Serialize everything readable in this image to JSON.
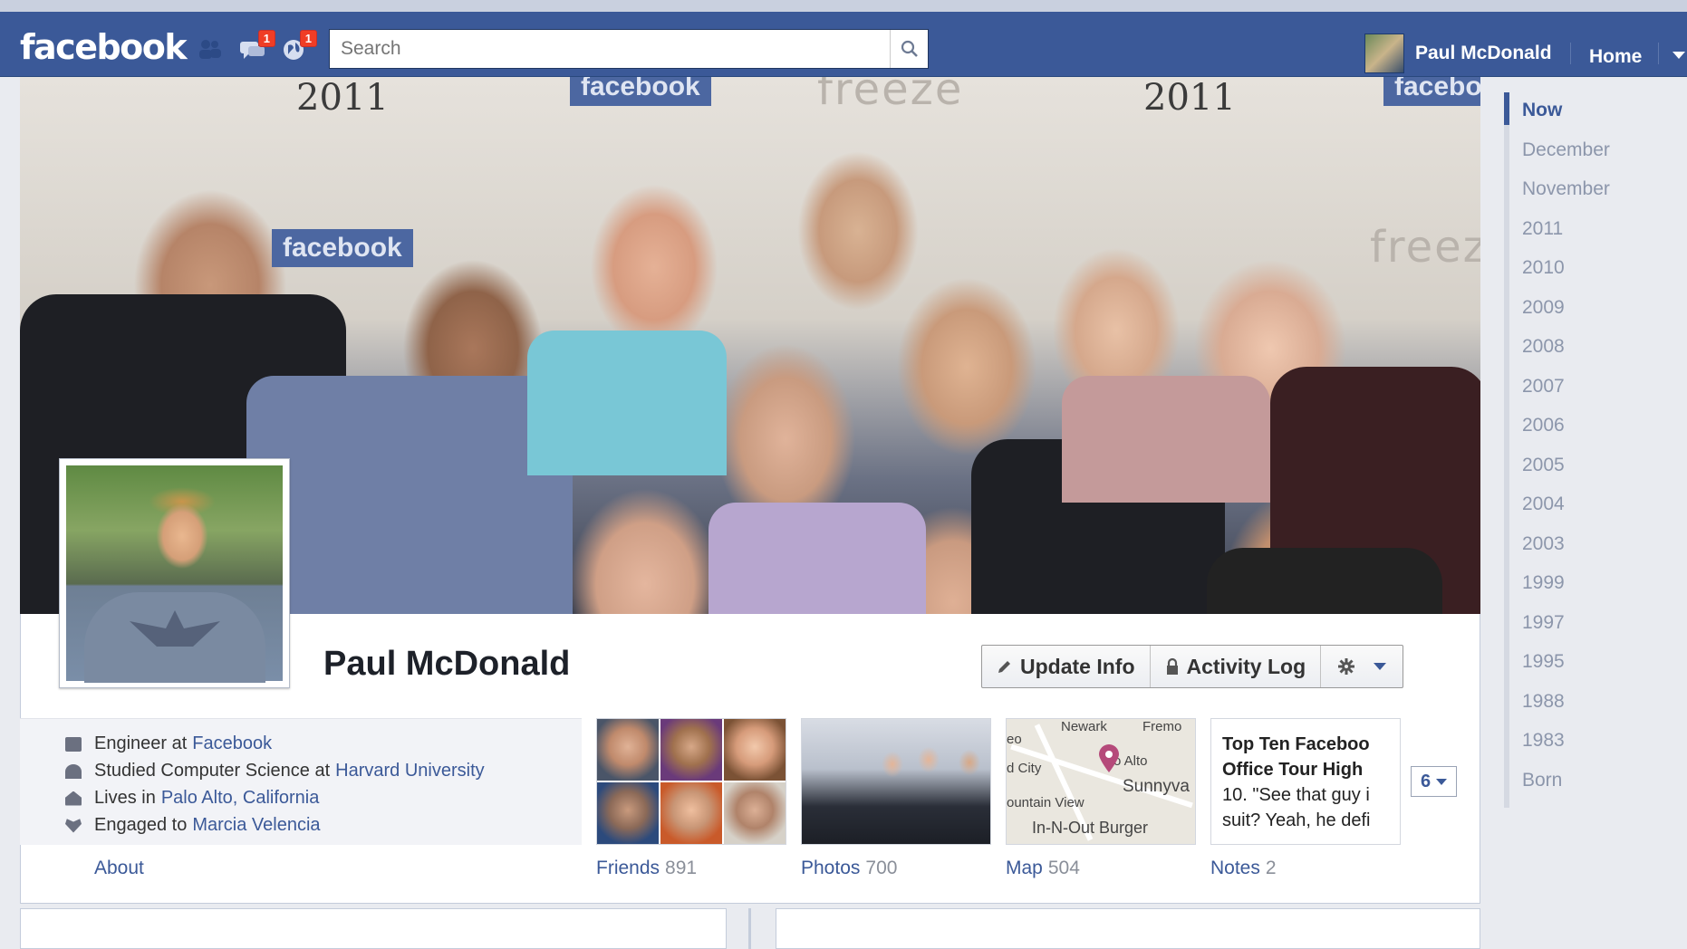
{
  "app": {
    "logo": "facebook"
  },
  "topbar": {
    "friend_requests": {
      "icon": "friends-icon",
      "count": ""
    },
    "messages": {
      "icon": "messages-icon",
      "count": "1"
    },
    "notifications": {
      "icon": "globe-icon",
      "count": "1"
    },
    "search": {
      "placeholder": "Search",
      "value": ""
    },
    "user_name": "Paul McDonald",
    "home_label": "Home"
  },
  "cover": {
    "year_left": "2011",
    "year_right": "2011",
    "stamp_top_left": "facebook",
    "stamp_mid": "facebook",
    "stamp_right": "facebo",
    "watermark": "freeze"
  },
  "profile": {
    "name": "Paul McDonald",
    "actions": {
      "update_info": "Update Info",
      "activity_log": "Activity Log"
    },
    "about": [
      {
        "icon": "briefcase-icon",
        "prefix": "Engineer at",
        "link": "Facebook"
      },
      {
        "icon": "graduation-cap-icon",
        "prefix": "Studied Computer Science at",
        "link": "Harvard University"
      },
      {
        "icon": "house-icon",
        "prefix": "Lives in",
        "link": "Palo Alto, California"
      },
      {
        "icon": "heart-icon",
        "prefix": "Engaged to",
        "link": "Marcia Velencia"
      }
    ],
    "tabs": [
      {
        "label": "About",
        "count": ""
      },
      {
        "label": "Friends",
        "count": "891"
      },
      {
        "label": "Photos",
        "count": "700"
      },
      {
        "label": "Map",
        "count": "504"
      },
      {
        "label": "Notes",
        "count": "2"
      }
    ],
    "map_labels": [
      "Newark",
      "Fremo",
      "eo",
      "d City",
      "o Alto",
      "Sunnyva",
      "ountain View",
      "In-N-Out Burger"
    ],
    "note_preview": [
      "Top Ten Faceboo",
      "Office Tour High",
      "10. \"See that guy i",
      "suit? Yeah, he defi"
    ],
    "more_count": "6"
  },
  "timeline": {
    "items": [
      "Now",
      "December",
      "November",
      "2011",
      "2010",
      "2009",
      "2008",
      "2007",
      "2006",
      "2005",
      "2004",
      "2003",
      "1999",
      "1997",
      "1995",
      "1988",
      "1983",
      "Born"
    ],
    "active": "Now"
  }
}
